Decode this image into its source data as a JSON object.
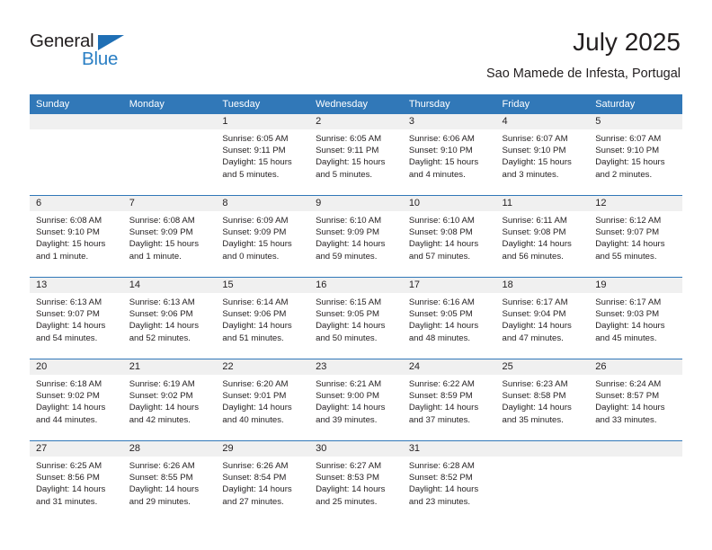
{
  "branding": {
    "name_dark": "General",
    "name_blue": "Blue",
    "triangle_color": "#1f6fb5",
    "blue_text_color": "#2a7fc4"
  },
  "header": {
    "month_title": "July 2025",
    "location": "Sao Mamede de Infesta, Portugal"
  },
  "theme": {
    "header_blue": "#3178b8",
    "day_band_gray": "#f0f0f0",
    "text_color": "#231f20"
  },
  "weekday_headers": [
    "Sunday",
    "Monday",
    "Tuesday",
    "Wednesday",
    "Thursday",
    "Friday",
    "Saturday"
  ],
  "weeks": [
    [
      {
        "day": "",
        "lines": []
      },
      {
        "day": "",
        "lines": []
      },
      {
        "day": "1",
        "lines": [
          "Sunrise: 6:05 AM",
          "Sunset: 9:11 PM",
          "Daylight: 15 hours",
          "and 5 minutes."
        ]
      },
      {
        "day": "2",
        "lines": [
          "Sunrise: 6:05 AM",
          "Sunset: 9:11 PM",
          "Daylight: 15 hours",
          "and 5 minutes."
        ]
      },
      {
        "day": "3",
        "lines": [
          "Sunrise: 6:06 AM",
          "Sunset: 9:10 PM",
          "Daylight: 15 hours",
          "and 4 minutes."
        ]
      },
      {
        "day": "4",
        "lines": [
          "Sunrise: 6:07 AM",
          "Sunset: 9:10 PM",
          "Daylight: 15 hours",
          "and 3 minutes."
        ]
      },
      {
        "day": "5",
        "lines": [
          "Sunrise: 6:07 AM",
          "Sunset: 9:10 PM",
          "Daylight: 15 hours",
          "and 2 minutes."
        ]
      }
    ],
    [
      {
        "day": "6",
        "lines": [
          "Sunrise: 6:08 AM",
          "Sunset: 9:10 PM",
          "Daylight: 15 hours",
          "and 1 minute."
        ]
      },
      {
        "day": "7",
        "lines": [
          "Sunrise: 6:08 AM",
          "Sunset: 9:09 PM",
          "Daylight: 15 hours",
          "and 1 minute."
        ]
      },
      {
        "day": "8",
        "lines": [
          "Sunrise: 6:09 AM",
          "Sunset: 9:09 PM",
          "Daylight: 15 hours",
          "and 0 minutes."
        ]
      },
      {
        "day": "9",
        "lines": [
          "Sunrise: 6:10 AM",
          "Sunset: 9:09 PM",
          "Daylight: 14 hours",
          "and 59 minutes."
        ]
      },
      {
        "day": "10",
        "lines": [
          "Sunrise: 6:10 AM",
          "Sunset: 9:08 PM",
          "Daylight: 14 hours",
          "and 57 minutes."
        ]
      },
      {
        "day": "11",
        "lines": [
          "Sunrise: 6:11 AM",
          "Sunset: 9:08 PM",
          "Daylight: 14 hours",
          "and 56 minutes."
        ]
      },
      {
        "day": "12",
        "lines": [
          "Sunrise: 6:12 AM",
          "Sunset: 9:07 PM",
          "Daylight: 14 hours",
          "and 55 minutes."
        ]
      }
    ],
    [
      {
        "day": "13",
        "lines": [
          "Sunrise: 6:13 AM",
          "Sunset: 9:07 PM",
          "Daylight: 14 hours",
          "and 54 minutes."
        ]
      },
      {
        "day": "14",
        "lines": [
          "Sunrise: 6:13 AM",
          "Sunset: 9:06 PM",
          "Daylight: 14 hours",
          "and 52 minutes."
        ]
      },
      {
        "day": "15",
        "lines": [
          "Sunrise: 6:14 AM",
          "Sunset: 9:06 PM",
          "Daylight: 14 hours",
          "and 51 minutes."
        ]
      },
      {
        "day": "16",
        "lines": [
          "Sunrise: 6:15 AM",
          "Sunset: 9:05 PM",
          "Daylight: 14 hours",
          "and 50 minutes."
        ]
      },
      {
        "day": "17",
        "lines": [
          "Sunrise: 6:16 AM",
          "Sunset: 9:05 PM",
          "Daylight: 14 hours",
          "and 48 minutes."
        ]
      },
      {
        "day": "18",
        "lines": [
          "Sunrise: 6:17 AM",
          "Sunset: 9:04 PM",
          "Daylight: 14 hours",
          "and 47 minutes."
        ]
      },
      {
        "day": "19",
        "lines": [
          "Sunrise: 6:17 AM",
          "Sunset: 9:03 PM",
          "Daylight: 14 hours",
          "and 45 minutes."
        ]
      }
    ],
    [
      {
        "day": "20",
        "lines": [
          "Sunrise: 6:18 AM",
          "Sunset: 9:02 PM",
          "Daylight: 14 hours",
          "and 44 minutes."
        ]
      },
      {
        "day": "21",
        "lines": [
          "Sunrise: 6:19 AM",
          "Sunset: 9:02 PM",
          "Daylight: 14 hours",
          "and 42 minutes."
        ]
      },
      {
        "day": "22",
        "lines": [
          "Sunrise: 6:20 AM",
          "Sunset: 9:01 PM",
          "Daylight: 14 hours",
          "and 40 minutes."
        ]
      },
      {
        "day": "23",
        "lines": [
          "Sunrise: 6:21 AM",
          "Sunset: 9:00 PM",
          "Daylight: 14 hours",
          "and 39 minutes."
        ]
      },
      {
        "day": "24",
        "lines": [
          "Sunrise: 6:22 AM",
          "Sunset: 8:59 PM",
          "Daylight: 14 hours",
          "and 37 minutes."
        ]
      },
      {
        "day": "25",
        "lines": [
          "Sunrise: 6:23 AM",
          "Sunset: 8:58 PM",
          "Daylight: 14 hours",
          "and 35 minutes."
        ]
      },
      {
        "day": "26",
        "lines": [
          "Sunrise: 6:24 AM",
          "Sunset: 8:57 PM",
          "Daylight: 14 hours",
          "and 33 minutes."
        ]
      }
    ],
    [
      {
        "day": "27",
        "lines": [
          "Sunrise: 6:25 AM",
          "Sunset: 8:56 PM",
          "Daylight: 14 hours",
          "and 31 minutes."
        ]
      },
      {
        "day": "28",
        "lines": [
          "Sunrise: 6:26 AM",
          "Sunset: 8:55 PM",
          "Daylight: 14 hours",
          "and 29 minutes."
        ]
      },
      {
        "day": "29",
        "lines": [
          "Sunrise: 6:26 AM",
          "Sunset: 8:54 PM",
          "Daylight: 14 hours",
          "and 27 minutes."
        ]
      },
      {
        "day": "30",
        "lines": [
          "Sunrise: 6:27 AM",
          "Sunset: 8:53 PM",
          "Daylight: 14 hours",
          "and 25 minutes."
        ]
      },
      {
        "day": "31",
        "lines": [
          "Sunrise: 6:28 AM",
          "Sunset: 8:52 PM",
          "Daylight: 14 hours",
          "and 23 minutes."
        ]
      },
      {
        "day": "",
        "lines": []
      },
      {
        "day": "",
        "lines": []
      }
    ]
  ]
}
